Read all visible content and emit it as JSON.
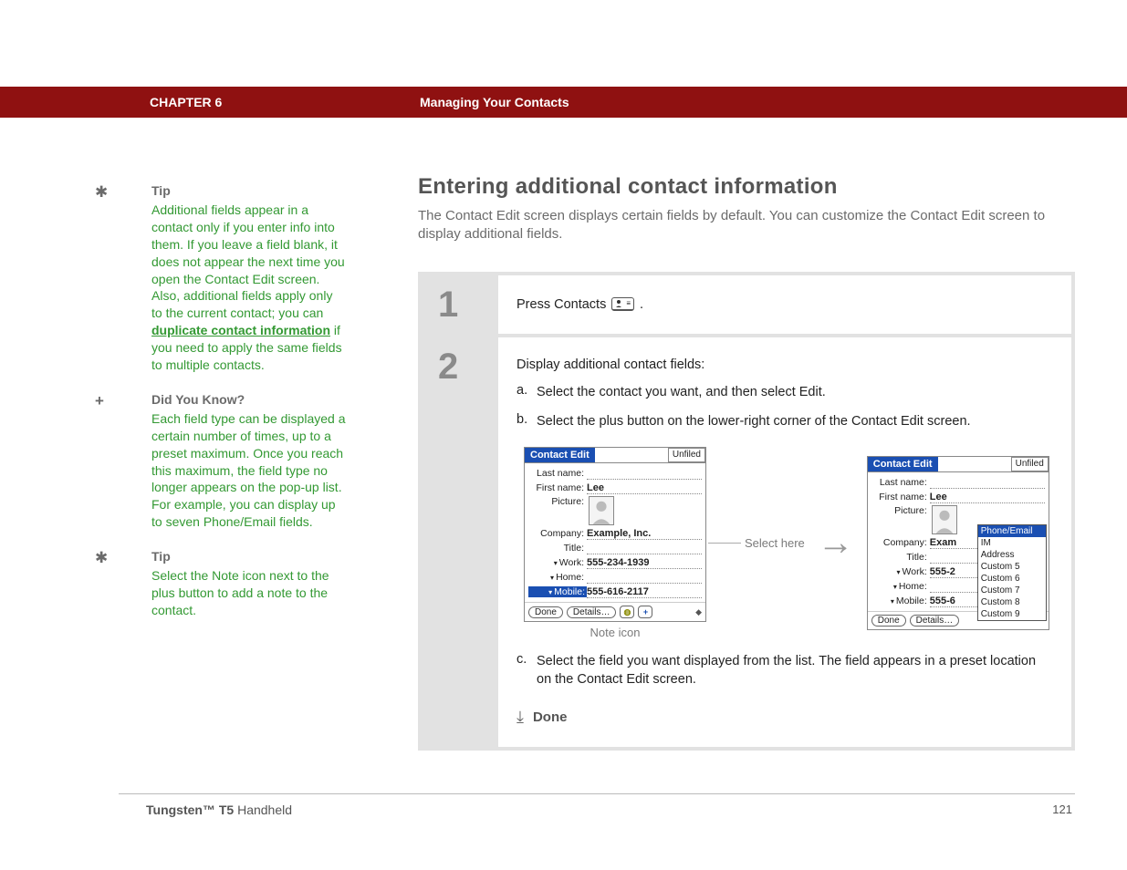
{
  "header": {
    "chapter_label": "CHAPTER 6",
    "chapter_title": "Managing Your Contacts"
  },
  "sidebar": {
    "blocks": [
      {
        "heading": "Tip",
        "icon": "asterisk",
        "body_pre": "Additional fields appear in a contact only if you enter info into them. If you leave a field blank, it does not appear the next time you open the Contact Edit screen. Also, additional fields apply only to the current contact; you can ",
        "link": "duplicate contact information",
        "body_post": " if you need to apply the same fields to multiple contacts."
      },
      {
        "heading": "Did You Know?",
        "icon": "plus",
        "body": "Each field type can be displayed a certain number of times, up to a preset maximum. Once you reach this maximum, the field type no longer appears on the pop-up list. For example, you can display up to seven Phone/Email fields."
      },
      {
        "heading": "Tip",
        "icon": "asterisk",
        "body": "Select the Note icon next to the plus button to add a note to the contact."
      }
    ]
  },
  "main": {
    "title": "Entering additional contact information",
    "intro": "The Contact Edit screen displays certain fields by default. You can customize the Contact Edit screen to display additional fields."
  },
  "steps": {
    "step1_num": "1",
    "step1_text": "Press Contacts ",
    "step1_suffix": ".",
    "step2_num": "2",
    "step2_lead": "Display additional contact fields:",
    "sub_a_letter": "a.",
    "sub_a_text": "Select the contact you want, and then select Edit.",
    "sub_b_letter": "b.",
    "sub_b_text": "Select the plus button on the lower-right corner of the Contact Edit screen.",
    "sub_c_letter": "c.",
    "sub_c_text": "Select the field you want displayed from the list. The field appears in a preset location on the Contact Edit screen.",
    "done_label": "Done",
    "callout_select": "Select here",
    "callout_note": "Note icon"
  },
  "pda": {
    "titlebar": "Contact Edit",
    "category": "Unfiled",
    "labels": {
      "last": "Last name:",
      "first": "First name:",
      "picture": "Picture:",
      "company": "Company:",
      "title": "Title:",
      "work": "Work:",
      "home": "Home:",
      "mobile": "Mobile:"
    },
    "values": {
      "first": "Lee",
      "company_full": "Example, Inc.",
      "company_trunc": "Exam",
      "work_full": "555-234-1939",
      "work_trunc": "555-2",
      "mobile_full": "555-616-2117",
      "mobile_trunc": "555-6"
    },
    "buttons": {
      "done": "Done",
      "details": "Details…"
    },
    "dropdown": [
      "Phone/Email",
      "IM",
      "Address",
      "Custom 5",
      "Custom 6",
      "Custom 7",
      "Custom 8",
      "Custom 9"
    ]
  },
  "footer": {
    "product_bold": "Tungsten™ T5",
    "product_rest": " Handheld",
    "page_number": "121"
  }
}
